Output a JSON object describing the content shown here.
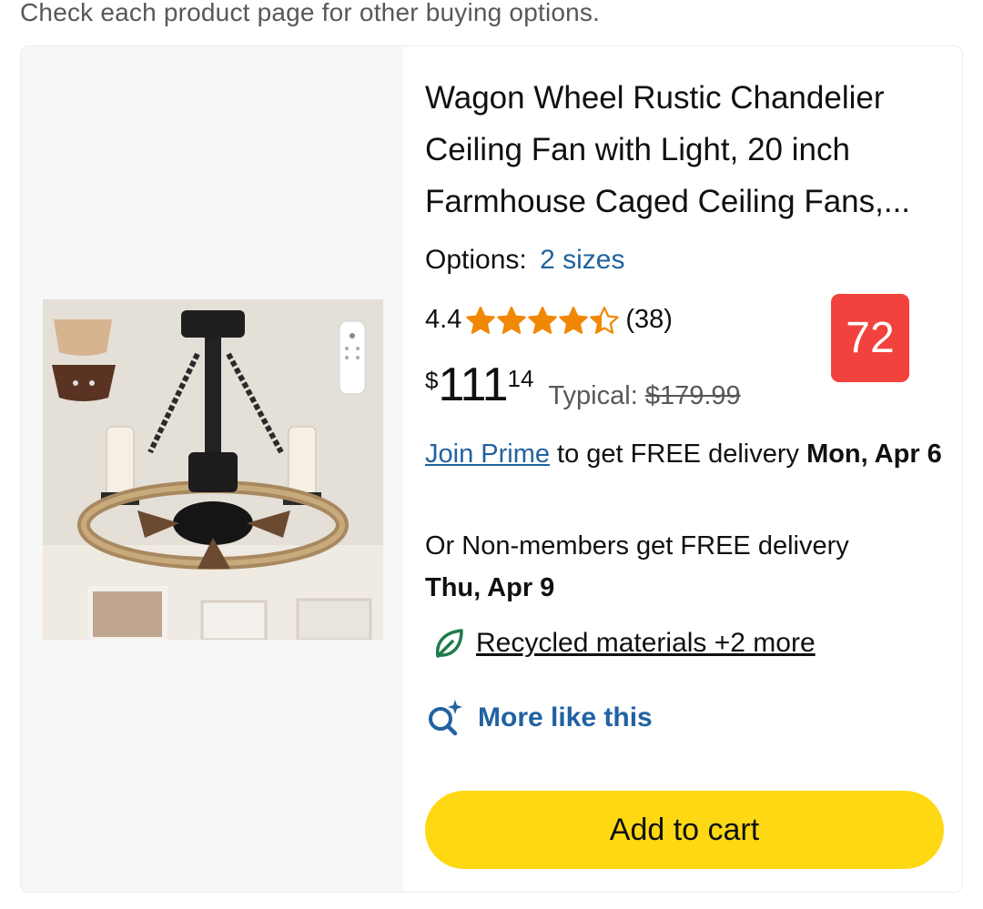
{
  "top_note": "Check each product page for other buying options.",
  "product": {
    "title": "Wagon Wheel Rustic Chandelier Ceiling Fan with Light, 20 inch Farmhouse Caged Ceiling Fans,...",
    "options_label": "Options:",
    "options_link": "2 sizes",
    "rating_value": "4.4",
    "rating_stars": 4.4,
    "rating_count": "(38)",
    "badge": "72",
    "price_symbol": "$",
    "price_whole": "111",
    "price_fraction": "14",
    "typical_label": "Typical:",
    "typical_price": "$179.99",
    "delivery_prime_link": "Join Prime",
    "delivery_prime_text": " to get FREE delivery ",
    "delivery_prime_date": "Mon, Apr 6",
    "delivery_nonmember_text": "Or Non-members get FREE delivery ",
    "delivery_nonmember_date": "Thu, Apr 9",
    "sustainability_link": "Recycled materials +2 more",
    "more_like_this": "More like this",
    "add_to_cart": "Add to cart"
  },
  "colors": {
    "link": "#2162a1",
    "star": "#f08804",
    "badge": "#f2423d",
    "cart_button": "#ffd814",
    "leaf_icon": "#1e7b4a"
  },
  "icons": {
    "star": "star-icon",
    "leaf": "leaf-icon",
    "sparkle_search": "sparkle-search-icon"
  }
}
